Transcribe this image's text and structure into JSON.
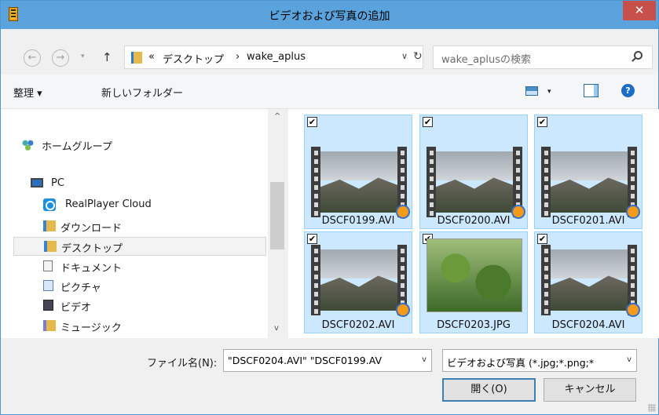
{
  "window": {
    "title": "ビデオおよび写真の追加",
    "close_glyph": "✕"
  },
  "nav": {
    "back_glyph": "←",
    "forward_glyph": "→",
    "dropdown_glyph": "▾",
    "up_glyph": "↑",
    "breadcrumb": {
      "prefix": "«",
      "segment1": "デスクトップ",
      "separator": "›",
      "segment2": "wake_aplus"
    },
    "address_dropdown_glyph": "∨",
    "refresh_glyph": "↻",
    "search_placeholder": "wake_aplusの検索"
  },
  "toolbar": {
    "organize": "整理 ▾",
    "new_folder": "新しいフォルダー",
    "view_dropdown_glyph": "▾",
    "help_glyph": "?"
  },
  "navpane": {
    "items": [
      {
        "label": "ホームグループ",
        "icon": "homegroup-icon"
      },
      {
        "label": "PC",
        "icon": "pc-icon"
      },
      {
        "label": "RealPlayer Cloud",
        "icon": "realplayer-icon"
      },
      {
        "label": "ダウンロード",
        "icon": "folder-icon"
      },
      {
        "label": "デスクトップ",
        "icon": "folder-icon",
        "selected": true
      },
      {
        "label": "ドキュメント",
        "icon": "document-icon"
      },
      {
        "label": "ピクチャ",
        "icon": "picture-icon"
      },
      {
        "label": "ビデオ",
        "icon": "video-icon"
      },
      {
        "label": "ミュージック",
        "icon": "music-icon"
      }
    ],
    "scroll_up_glyph": "^",
    "scroll_down_glyph": "v"
  },
  "files": [
    {
      "name": "DSCF0199.AVI",
      "checked": "✔"
    },
    {
      "name": "DSCF0200.AVI",
      "checked": "✔"
    },
    {
      "name": "DSCF0201.AVI",
      "checked": "✔"
    },
    {
      "name": "DSCF0202.AVI",
      "checked": "✔"
    },
    {
      "name": "DSCF0203.JPG",
      "checked": "✔"
    },
    {
      "name": "DSCF0204.AVI",
      "checked": "✔"
    }
  ],
  "bottom": {
    "filename_label": "ファイル名(N):",
    "filename_value": "\"DSCF0204.AVI\" \"DSCF0199.AV",
    "filetype_value": "ビデオおよび写真 (*.jpg;*.png;*",
    "combo_arrow": "v",
    "open_button": "開く(O)",
    "cancel_button": "キャンセル"
  },
  "colors": {
    "titlebar": "#5aa3dd",
    "selection": "#cce8ff",
    "close": "#c7504a"
  }
}
